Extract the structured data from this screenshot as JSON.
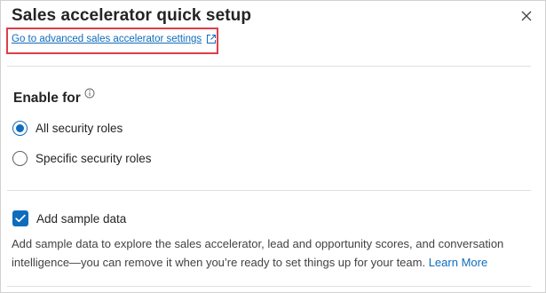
{
  "panel": {
    "title": "Sales accelerator quick setup",
    "advanced_link_label": "Go to advanced sales accelerator settings"
  },
  "enable_for": {
    "heading": "Enable for",
    "options": [
      {
        "label": "All security roles",
        "selected": true
      },
      {
        "label": "Specific security roles",
        "selected": false
      }
    ]
  },
  "sample_data": {
    "checkbox_label": "Add sample data",
    "checked": true,
    "description": "Add sample data to explore the sales accelerator, lead and opportunity scores, and conversation intelligence—you can remove it when you’re ready to set things up for your team.",
    "learn_more_label": "Learn More"
  },
  "colors": {
    "accent": "#0f6cbd",
    "highlight": "#e03e46"
  },
  "icons": {
    "external": "external-link-icon",
    "info": "info-icon",
    "close": "close-icon",
    "check": "checkmark-icon"
  }
}
